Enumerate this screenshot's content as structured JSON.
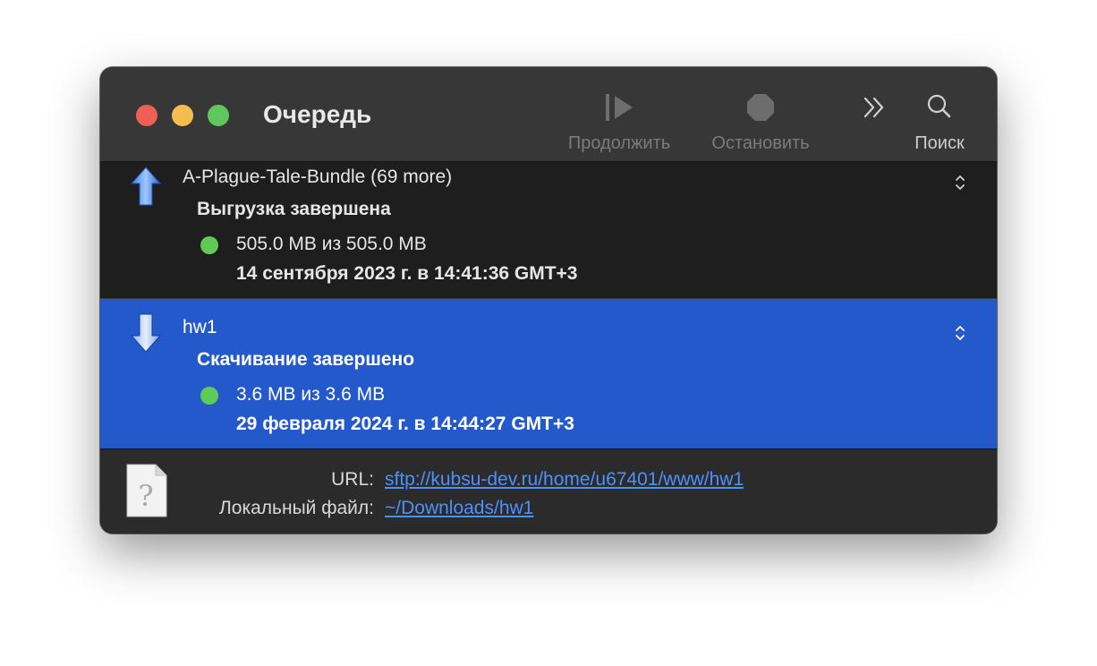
{
  "window": {
    "title": "Очередь"
  },
  "toolbar": {
    "resume": {
      "label": "Продолжить",
      "icon": "resume-icon",
      "enabled": false
    },
    "stop": {
      "label": "Остановить",
      "icon": "stop-icon",
      "enabled": false
    },
    "more": {
      "icon": "chevron-double-right-icon"
    },
    "search": {
      "label": "Поиск",
      "icon": "search-icon"
    }
  },
  "transfers": [
    {
      "icon": "upload-arrow-icon",
      "name": "A-Plague-Tale-Bundle (69 more)",
      "status": "Выгрузка завершена",
      "size": "505.0 MB из 505.0 MB",
      "date": "14 сентября 2023 г. в 14:41:36 GMT+3",
      "selected": false
    },
    {
      "icon": "download-arrow-icon",
      "name": "hw1",
      "status": "Скачивание завершено",
      "size": "3.6 MB из 3.6 MB",
      "date": "29 февраля 2024 г. в 14:44:27 GMT+3",
      "selected": true
    }
  ],
  "details": {
    "url_label": "URL:",
    "url_value": "sftp://kubsu-dev.ru/home/u67401/www/hw1",
    "local_label": "Локальный файл:",
    "local_value": "~/Downloads/hw1"
  },
  "colors": {
    "selection": "#2459cb",
    "link": "#4d91ff",
    "status_dot": "#5fcb56",
    "close": "#ee5f57",
    "minimize": "#f4bd4f",
    "maximize": "#5fc75d"
  }
}
